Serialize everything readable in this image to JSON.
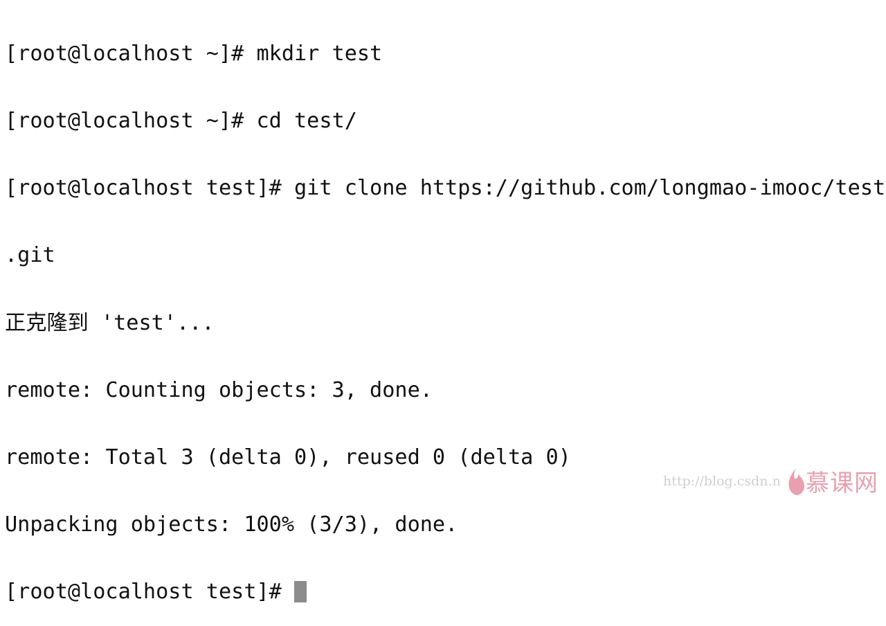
{
  "terminal": {
    "lines": [
      "[root@localhost ~]# mkdir test",
      "[root@localhost ~]# cd test/",
      "[root@localhost test]# git clone https://github.com/longmao-imooc/test",
      ".git",
      "正克隆到 'test'...",
      "remote: Counting objects: 3, done.",
      "remote: Total 3 (delta 0), reused 0 (delta 0)",
      "Unpacking objects: 100% (3/3), done."
    ],
    "prompt": "[root@localhost test]# ",
    "cursor_color": "#8c8c8c"
  },
  "watermark": {
    "url": "http://blog.csdn.n",
    "logo_text": "慕课网",
    "logo_color": "#e8a0b0"
  }
}
